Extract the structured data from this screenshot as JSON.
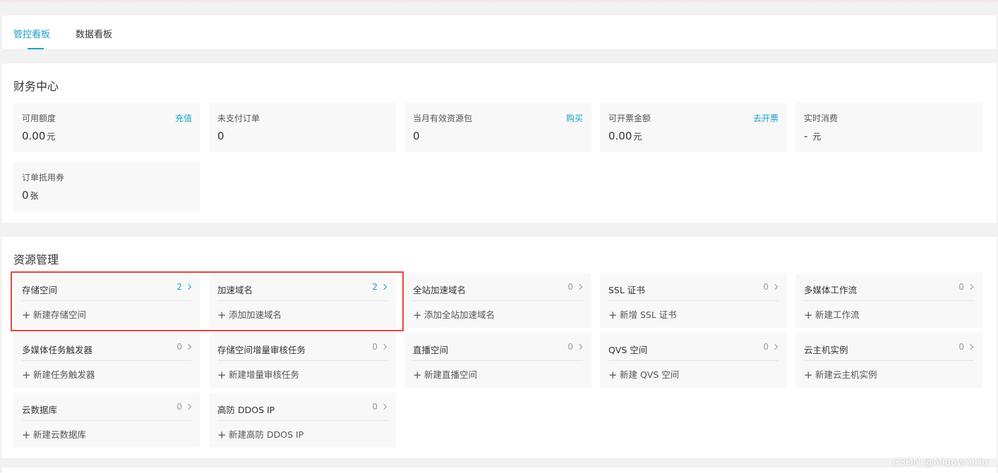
{
  "tabs": [
    {
      "label": "管控看板",
      "active": true
    },
    {
      "label": "数据看板",
      "active": false
    }
  ],
  "finance": {
    "title": "财务中心",
    "cards": [
      {
        "label": "可用额度",
        "action": "充值",
        "value": "0.00",
        "unit": "元"
      },
      {
        "label": "未支付订单",
        "action": "",
        "value": "0",
        "unit": ""
      },
      {
        "label": "当月有效资源包",
        "action": "购买",
        "value": "0",
        "unit": ""
      },
      {
        "label": "可开票金额",
        "action": "去开票",
        "value": "0.00",
        "unit": "元"
      },
      {
        "label": "实时消费",
        "action": "",
        "value": "-",
        "unit": "元"
      },
      {
        "label": "订单抵用券",
        "action": "",
        "value": "0",
        "unit": "张"
      }
    ]
  },
  "resources": {
    "title": "资源管理",
    "cards": [
      {
        "title": "存储空间",
        "count": "2",
        "action": "新建存储空间"
      },
      {
        "title": "加速域名",
        "count": "2",
        "action": "添加加速域名"
      },
      {
        "title": "全站加速域名",
        "count": "0",
        "action": "添加全站加速域名"
      },
      {
        "title": "SSL 证书",
        "count": "0",
        "action": "新增 SSL 证书"
      },
      {
        "title": "多媒体工作流",
        "count": "0",
        "action": "新建工作流"
      },
      {
        "title": "多媒体任务触发器",
        "count": "0",
        "action": "新建任务触发器"
      },
      {
        "title": "存储空间增量审核任务",
        "count": "0",
        "action": "新建增量审核任务"
      },
      {
        "title": "直播空间",
        "count": "0",
        "action": "新建直播空间"
      },
      {
        "title": "QVS 空间",
        "count": "0",
        "action": "新建 QVS 空间"
      },
      {
        "title": "云主机实例",
        "count": "0",
        "action": "新建云主机实例"
      },
      {
        "title": "云数据库",
        "count": "0",
        "action": "新建云数据库"
      },
      {
        "title": "高防 DDOS IP",
        "count": "0",
        "action": "新建高防 DDOS IP"
      }
    ]
  },
  "watermark": "CSDN @Miaow.Y.Hu",
  "colors": {
    "accent": "#1ea0c8",
    "highlight": "#e8453c",
    "card_bg": "#f8f8f8"
  },
  "icons": {
    "plus": "plus-icon",
    "chevron": "chevron-right-icon"
  }
}
